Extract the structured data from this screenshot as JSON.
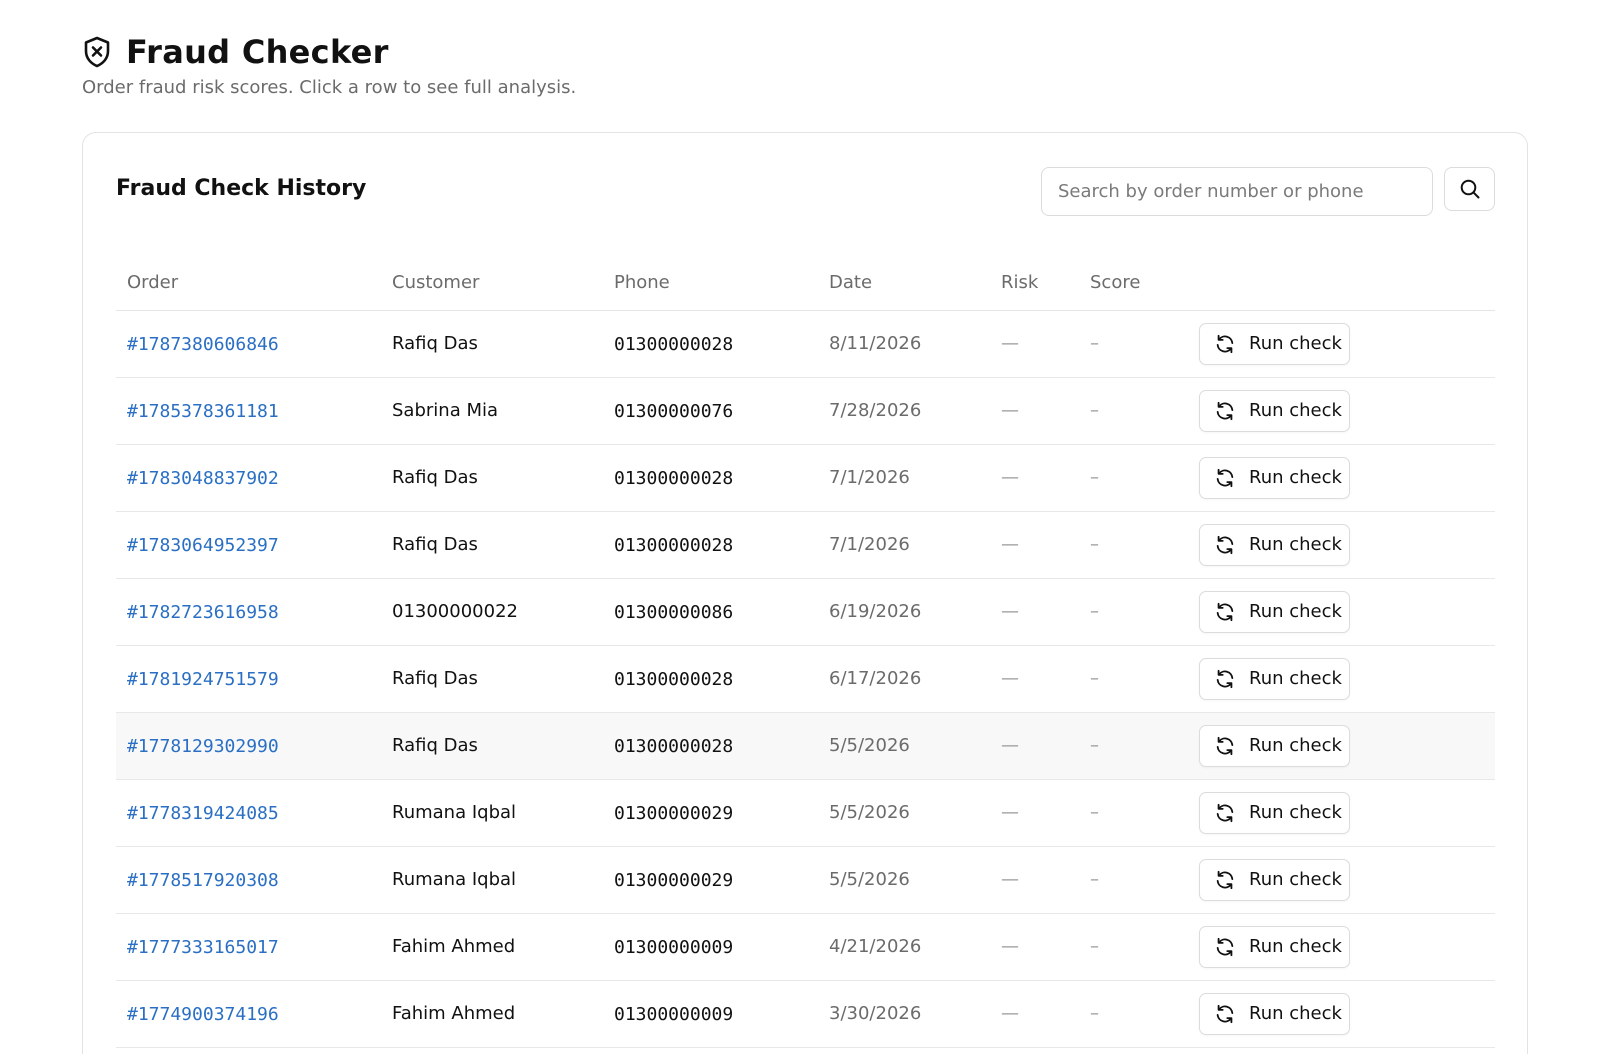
{
  "header": {
    "title": "Fraud Checker",
    "subtitle": "Order fraud risk scores. Click a row to see full analysis.",
    "icon": "shield-x-icon"
  },
  "history": {
    "title": "Fraud Check History",
    "search": {
      "placeholder": "Search by order number or phone",
      "value": ""
    },
    "search_button_icon": "search-icon",
    "columns": {
      "order": "Order",
      "customer": "Customer",
      "phone": "Phone",
      "date": "Date",
      "risk": "Risk",
      "score": "Score"
    },
    "rows": [
      {
        "order": "#1787380606846",
        "customer": "Rafiq Das",
        "phone": "01300000028",
        "date": "8/11/2026",
        "risk": "—",
        "score": "–",
        "action": "Run check"
      },
      {
        "order": "#1785378361181",
        "customer": "Sabrina Mia",
        "phone": "01300000076",
        "date": "7/28/2026",
        "risk": "—",
        "score": "–",
        "action": "Run check"
      },
      {
        "order": "#1783048837902",
        "customer": "Rafiq Das",
        "phone": "01300000028",
        "date": "7/1/2026",
        "risk": "—",
        "score": "–",
        "action": "Run check"
      },
      {
        "order": "#1783064952397",
        "customer": "Rafiq Das",
        "phone": "01300000028",
        "date": "7/1/2026",
        "risk": "—",
        "score": "–",
        "action": "Run check"
      },
      {
        "order": "#1782723616958",
        "customer": "01300000022",
        "phone": "01300000086",
        "date": "6/19/2026",
        "risk": "—",
        "score": "–",
        "action": "Run check"
      },
      {
        "order": "#1781924751579",
        "customer": "Rafiq Das",
        "phone": "01300000028",
        "date": "6/17/2026",
        "risk": "—",
        "score": "–",
        "action": "Run check"
      },
      {
        "order": "#1778129302990",
        "customer": "Rafiq Das",
        "phone": "01300000028",
        "date": "5/5/2026",
        "risk": "—",
        "score": "–",
        "action": "Run check"
      },
      {
        "order": "#1778319424085",
        "customer": "Rumana Iqbal",
        "phone": "01300000029",
        "date": "5/5/2026",
        "risk": "—",
        "score": "–",
        "action": "Run check"
      },
      {
        "order": "#1778517920308",
        "customer": "Rumana Iqbal",
        "phone": "01300000029",
        "date": "5/5/2026",
        "risk": "—",
        "score": "–",
        "action": "Run check"
      },
      {
        "order": "#1777333165017",
        "customer": "Fahim Ahmed",
        "phone": "01300000009",
        "date": "4/21/2026",
        "risk": "—",
        "score": "–",
        "action": "Run check"
      },
      {
        "order": "#1774900374196",
        "customer": "Fahim Ahmed",
        "phone": "01300000009",
        "date": "3/30/2026",
        "risk": "—",
        "score": "–",
        "action": "Run check"
      }
    ]
  },
  "colors": {
    "link": "#2a6fc4",
    "muted": "#6b6b6b",
    "border": "#e3e3e3",
    "hover_row": "#f8f8f8"
  }
}
